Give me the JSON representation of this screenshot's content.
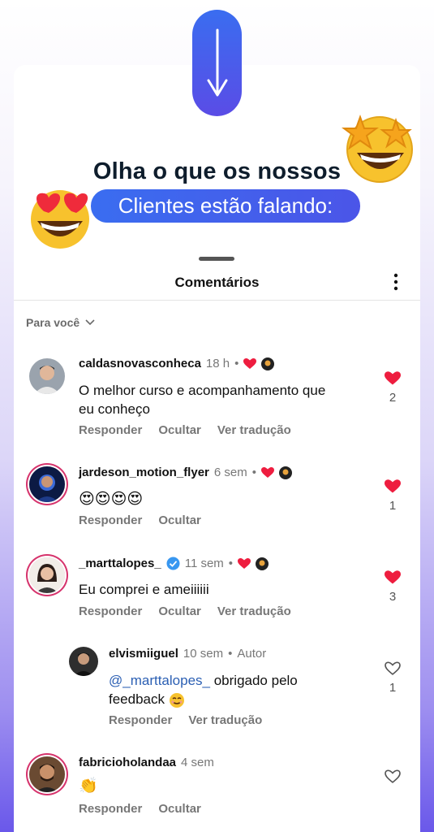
{
  "promo": {
    "headline": "Olha o que os nossos",
    "subheadline": "Clientes estão falando:"
  },
  "sheet": {
    "title": "Comentários",
    "filter_label": "Para você"
  },
  "comments": [
    {
      "username": "caldasnovasconheca",
      "time": "18 h",
      "text_line1": "O melhor curso e acompanhamento que",
      "text_line2": "eu conheço",
      "actions": [
        "Responder",
        "Ocultar",
        "Ver tradução"
      ],
      "likes": "2",
      "liked": true
    },
    {
      "username": "jardeson_motion_flyer",
      "time": "6 sem",
      "text": "😍😍😍😍",
      "actions": [
        "Responder",
        "Ocultar"
      ],
      "likes": "1",
      "liked": true
    },
    {
      "username": "_marttalopes_",
      "time": "11 sem",
      "verified": true,
      "text": "Eu comprei e ameiiiiii",
      "actions": [
        "Responder",
        "Ocultar",
        "Ver tradução"
      ],
      "likes": "3",
      "liked": true
    },
    {
      "username": "elvismiiguel",
      "time": "10 sem",
      "author_tag": "Autor",
      "mention": "@_marttalopes_",
      "text_after_mention": " obrigado pelo",
      "text_line2": "feedback",
      "actions": [
        "Responder",
        "Ver tradução"
      ],
      "likes": "1",
      "liked": false
    },
    {
      "username": "fabricioholandaa",
      "time": "4 sem",
      "text": "👏",
      "actions": [
        "Responder",
        "Ocultar"
      ],
      "liked": false
    }
  ],
  "colors": {
    "accent_blue": "#3a6df0",
    "like_red": "#ee1d3f",
    "story_ring": "#d6336c"
  }
}
